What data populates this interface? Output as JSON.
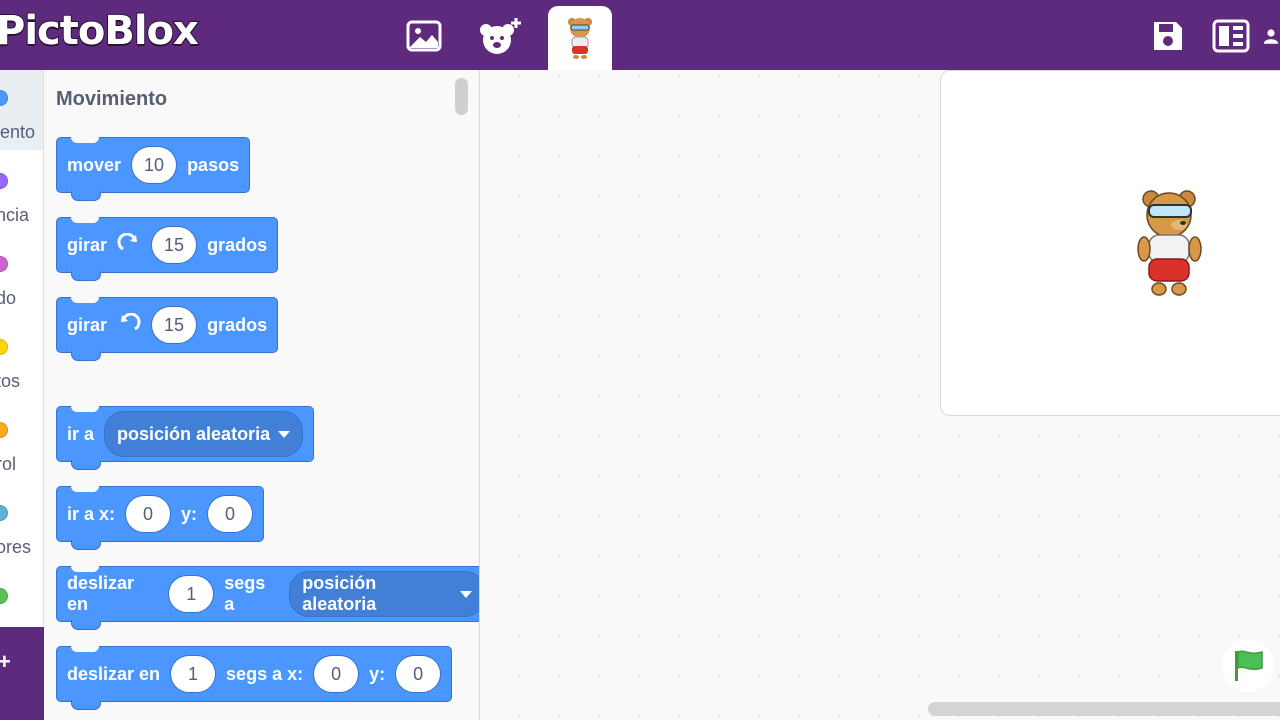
{
  "app": {
    "logo_text": "PictoBlox"
  },
  "palette": {
    "title": "Movimiento",
    "blocks": {
      "move": {
        "label": "mover",
        "value": "10",
        "suffix": "pasos"
      },
      "turn_right": {
        "label": "girar",
        "value": "15",
        "suffix": "grados"
      },
      "turn_left": {
        "label": "girar",
        "value": "15",
        "suffix": "grados"
      },
      "goto": {
        "label": "ir a",
        "option": "posición aleatoria"
      },
      "goto_xy": {
        "label": "ir a x:",
        "x": "0",
        "ylabel": "y:",
        "y": "0"
      },
      "glide": {
        "label": "deslizar en",
        "value": "1",
        "mid": "segs a",
        "option": "posición aleatoria"
      },
      "glide_xy": {
        "label": "deslizar en",
        "value": "1",
        "mid": "segs a x:",
        "x": "0",
        "ylabel": "y:",
        "y": "0"
      }
    }
  },
  "categories": [
    {
      "label": "iento",
      "color": "#4c97ff"
    },
    {
      "label": "ncia",
      "color": "#9966ff"
    },
    {
      "label": "do",
      "color": "#cf63cf"
    },
    {
      "label": "tos",
      "color": "#ffd500"
    },
    {
      "label": "rol",
      "color": "#ffab19"
    },
    {
      "label": "ores",
      "color": "#5cb1d6"
    },
    {
      "label": "",
      "color": "#59c059"
    }
  ],
  "colors": {
    "topbar": "#5e2a7e",
    "motion": "#4c97ff",
    "flag": "#4cbf56"
  }
}
